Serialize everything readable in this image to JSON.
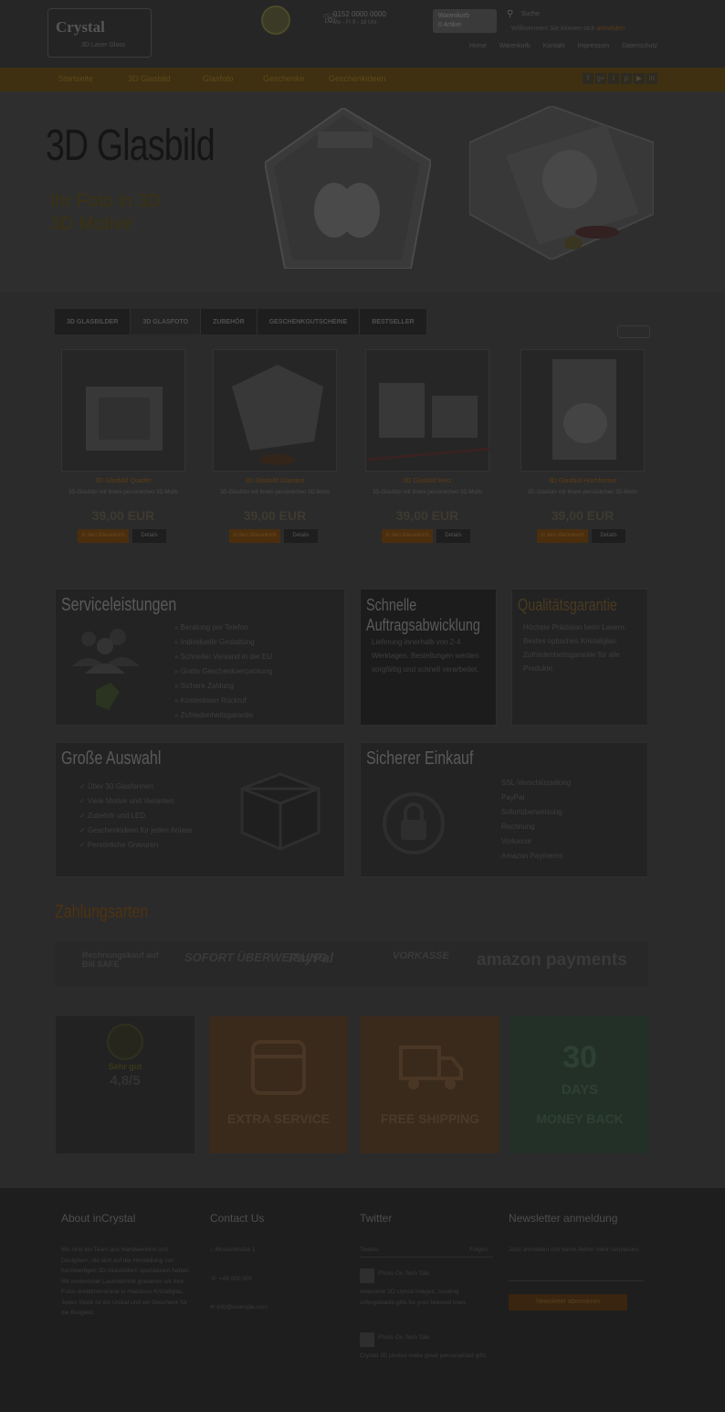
{
  "header": {
    "brand": "Crystal",
    "tagline": "3D Laser Glass",
    "phone_number": "0152 0000 0000",
    "phone_hours": "Mo - Fr 9 - 18 Uhr",
    "cart_line1": "Warenkorb",
    "cart_line2": "0 Artikel",
    "search_placeholder": "Suche",
    "account_text": "Willkommen! Sie können sich",
    "account_link": "anmelden",
    "topnav": [
      "Home",
      "Warenkorb",
      "Kontakt",
      "Impressum",
      "Datenschutz"
    ]
  },
  "nav": {
    "items": [
      "Startseite",
      "3D Glasbild",
      "Glasfoto",
      "Geschenke",
      "Geschenkideen"
    ],
    "social": [
      "f",
      "g+",
      "t",
      "p",
      "▶",
      "in"
    ]
  },
  "hero": {
    "title": "3D Glasbild",
    "sub1": "Ihr Foto in 3D",
    "sub2": "3D Motive"
  },
  "tabs": [
    "3D GLASBILDER",
    "3D GLASFOTO",
    "ZUBEHÖR",
    "GESCHENKGUTSCHEINE",
    "BESTSELLER"
  ],
  "products": [
    {
      "name": "3D Glasbild Quader",
      "desc": "3D-Glasfoto mit Ihrem persönlichen 3D-Motiv",
      "price": "39,00 EUR",
      "buy": "In den Warenkorb",
      "more": "Details"
    },
    {
      "name": "3D Glasbild Diamant",
      "desc": "3D-Glasfoto mit Ihrem persönlichen 3D-Motiv",
      "price": "39,00 EUR",
      "buy": "In den Warenkorb",
      "more": "Details"
    },
    {
      "name": "3D Glasbild Herz",
      "desc": "3D-Glasfoto mit Ihrem persönlichen 3D-Motiv",
      "price": "39,00 EUR",
      "buy": "In den Warenkorb",
      "more": "Details"
    },
    {
      "name": "3D Glasbild Hochformat",
      "desc": "3D-Glasfoto mit Ihrem persönlichen 3D-Motiv",
      "price": "39,00 EUR",
      "buy": "In den Warenkorb",
      "more": "Details"
    }
  ],
  "service": {
    "title": "Serviceleistungen",
    "items": [
      "» Beratung per Telefon",
      "» Individuelle Gestaltung",
      "» Schneller Versand in der EU",
      "» Gratis Geschenkverpackung",
      "» Sichere Zahlung",
      "» Kostenloser Rückruf",
      "» Zufriedenheitsgarantie"
    ]
  },
  "fast": {
    "title1": "Schnelle",
    "title2": "Auftragsabwicklung",
    "text": "Lieferung innerhalb von 2-4 Werktagen. Bestellungen werden sorgfältig und schnell verarbeitet."
  },
  "quality": {
    "title": "Qualitätsgarantie",
    "text": "Höchste Präzision beim Lasern. Bestes optisches Kristallglas. Zufriedenheitsgarantie für alle Produkte."
  },
  "selection": {
    "title": "Große Auswahl",
    "items": [
      "✓ Über 30 Glasformen",
      "✓ Viele Motive und Varianten",
      "✓ Zubehör und LED",
      "✓ Geschenkideen für jeden Anlass",
      "✓ Persönliche Gravuren"
    ]
  },
  "secure": {
    "title": "Sicherer Einkauf",
    "items": [
      "SSL-Verschlüsselung",
      "PayPal",
      "Sofortüberweisung",
      "Rechnung",
      "Vorkasse",
      "Amazon Payments"
    ]
  },
  "payment": {
    "title": "Zahlungsarten",
    "methods": [
      "Rechnungskauf auf Bill SAFE",
      "SOFORT ÜBERWEISUNG",
      "PayPal",
      "VORKASSE",
      "amazon payments"
    ]
  },
  "badges": {
    "rating": "4,8/5",
    "rating_label": "Sehr gut",
    "extra": "EXTRA SERVICE",
    "shipping": "FREE SHIPPING",
    "days_num": "30",
    "days_label": "DAYS",
    "moneyback": "MONEY BACK"
  },
  "footer": {
    "about_title": "About inCrystal",
    "about_text": "Wir sind ein Team aus Handwerkern und Designern, die sich auf die Herstellung von hochwertigen 3D-Glasbildern spezialisiert haben. Mit modernster Lasertechnik gravieren wir Ihre Fotos dreidimensional in massives Kristallglas. Jedes Stück ist ein Unikat und ein Geschenk für die Ewigkeit.",
    "contact_title": "Contact Us",
    "contact_lines": [
      "Musterstraße 1",
      "+49 000 000",
      "info@example.com"
    ],
    "twitter_title": "Twitter",
    "tweet_label": "Tweets",
    "tweet_follow": "Folgen",
    "tweet1_user": "Photo On Tech Talk",
    "tweet1_text": "Awesome 3D crystal images, creating unforgettable gifts for your beloved ones",
    "tweet2_user": "Photo On Tech Talk",
    "tweet2_text": "Crystal 3D photos make great personalized gifts",
    "news_title": "Newsletter anmeldung",
    "news_text": "Jetzt anmelden und keine Aktion mehr verpassen.",
    "news_button": "Newsletter abonnieren"
  }
}
